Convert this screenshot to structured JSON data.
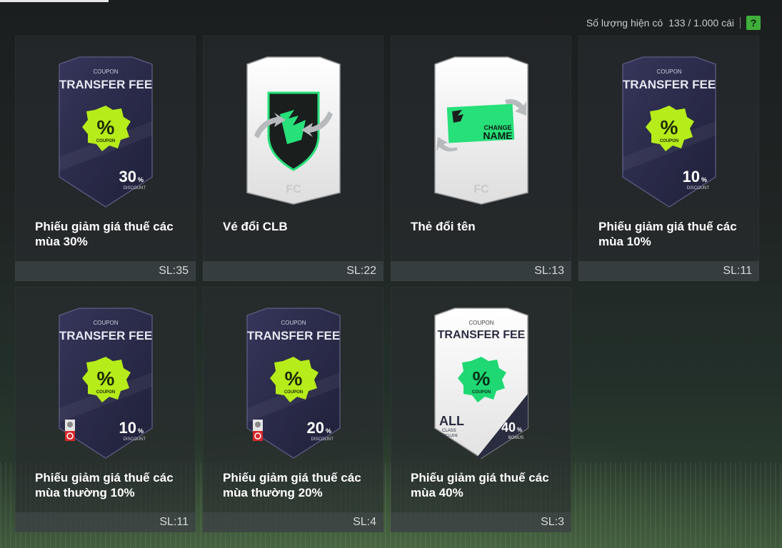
{
  "header": {
    "inventory_label": "Số lượng hiện có",
    "inventory_count": "133 / 1.000 cái",
    "help_label": "?"
  },
  "items": [
    {
      "name": "Phiếu giảm giá thuế các mùa 30%",
      "qty": "SL:35",
      "art": {
        "coupon": "COUPON",
        "title": "TRANSFER FEE",
        "badge_symbol": "%",
        "badge_text": "COUPON",
        "amount": "30",
        "unit": "%",
        "amount_label": "DISCOUNT"
      }
    },
    {
      "name": "Vé đổi CLB",
      "qty": "SL:22",
      "art": {
        "icon": "club-change-shield-icon"
      }
    },
    {
      "name": "Thẻ đổi tên",
      "qty": "SL:13",
      "art": {
        "line1": "CHANGE",
        "line2": "NAME"
      }
    },
    {
      "name": "Phiếu giảm giá thuế các mùa 10%",
      "qty": "SL:11",
      "art": {
        "coupon": "COUPON",
        "title": "TRANSFER FEE",
        "badge_symbol": "%",
        "badge_text": "COUPON",
        "amount": "10",
        "unit": "%",
        "amount_label": "DISCOUNT"
      }
    },
    {
      "name": "Phiếu giảm giá thuế các mùa thường 10%",
      "qty": "SL:11",
      "art": {
        "coupon": "COUPON",
        "title": "TRANSFER FEE",
        "badge_symbol": "%",
        "badge_text": "COUPON",
        "amount": "10",
        "unit": "%",
        "amount_label": "DISCOUNT"
      }
    },
    {
      "name": "Phiếu giảm giá thuế các mùa thường 20%",
      "qty": "SL:4",
      "art": {
        "coupon": "COUPON",
        "title": "TRANSFER FEE",
        "badge_symbol": "%",
        "badge_text": "COUPON",
        "amount": "20",
        "unit": "%",
        "amount_label": "DISCOUNT"
      }
    },
    {
      "name": "Phiếu giảm giá thuế các mùa 40%",
      "qty": "SL:3",
      "art": {
        "coupon": "COUPON",
        "title": "TRANSFER FEE",
        "badge_symbol": "%",
        "badge_text": "COUPON",
        "amount": "40",
        "unit": "%",
        "amount_label": "BONUS",
        "all_label": "ALL",
        "class_label": "CLASS",
        "include_label": "INCLUDE"
      }
    }
  ],
  "colors": {
    "dark_card": "#2b2c4a",
    "badge_lime": "#b6ec1a",
    "badge_green": "#1fd873",
    "accent_green": "#3fae3a"
  }
}
